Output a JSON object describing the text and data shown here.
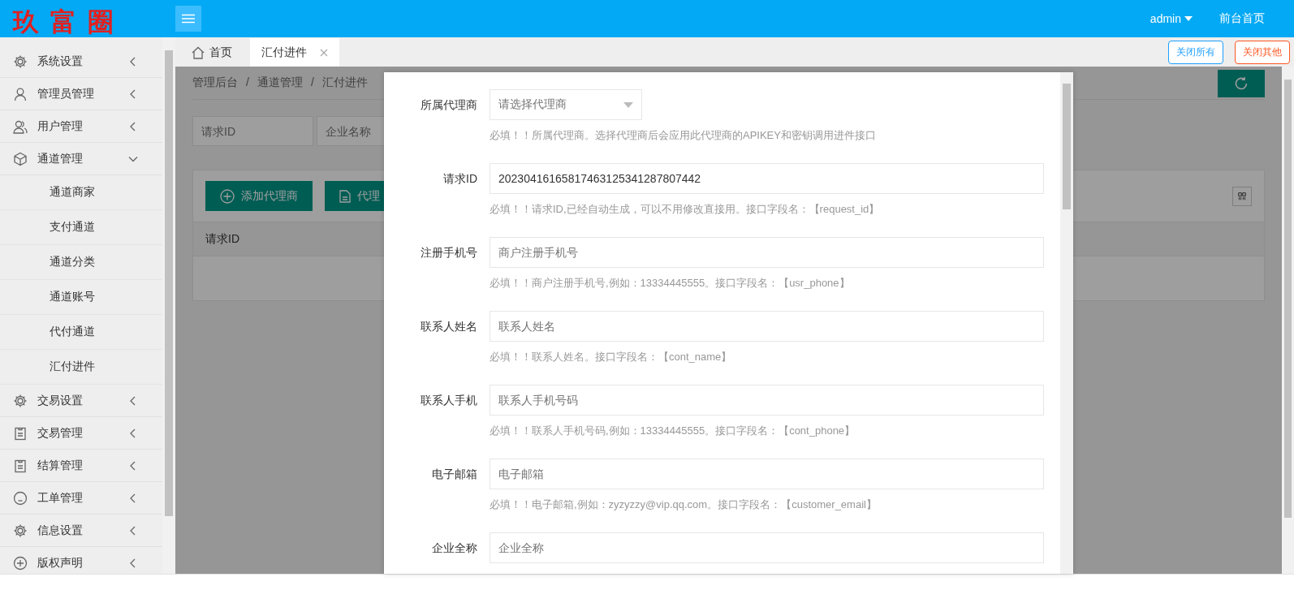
{
  "header": {
    "logo": "玖富圈",
    "user": "admin",
    "home_link": "前台首页"
  },
  "sidebar": {
    "items": [
      {
        "label": "系统设置",
        "expanded": false
      },
      {
        "label": "管理员管理",
        "expanded": false
      },
      {
        "label": "用户管理",
        "expanded": false
      },
      {
        "label": "通道管理",
        "expanded": true,
        "children": [
          {
            "label": "通道商家"
          },
          {
            "label": "支付通道"
          },
          {
            "label": "通道分类"
          },
          {
            "label": "通道账号"
          },
          {
            "label": "代付通道"
          },
          {
            "label": "汇付进件"
          }
        ]
      },
      {
        "label": "交易设置",
        "expanded": false
      },
      {
        "label": "交易管理",
        "expanded": false
      },
      {
        "label": "结算管理",
        "expanded": false
      },
      {
        "label": "工单管理",
        "expanded": false
      },
      {
        "label": "信息设置",
        "expanded": false
      },
      {
        "label": "版权声明",
        "expanded": false
      }
    ]
  },
  "tabs": [
    {
      "label": "首页",
      "selected": false,
      "closable": false
    },
    {
      "label": "汇付进件",
      "selected": true,
      "closable": true
    }
  ],
  "tab_actions": [
    {
      "label": "关闭所有",
      "kind": "primary"
    },
    {
      "label": "关闭其他",
      "kind": "danger"
    }
  ],
  "page": {
    "breadcrumb": {
      "separator": "/",
      "items": [
        "管理后台",
        "通道管理",
        "汇付进件"
      ]
    },
    "search_fields": [
      {
        "placeholder": "请求ID"
      },
      {
        "placeholder": "企业名称"
      }
    ],
    "toolbar_buttons": [
      {
        "label": "添加代理商",
        "kind": "add"
      },
      {
        "label": "代理",
        "kind": "doc"
      }
    ],
    "table": {
      "columns": [
        "请求ID"
      ]
    }
  },
  "modal": {
    "fields": [
      {
        "kind": "select",
        "label": "所属代理商",
        "placeholder": "请选择代理商",
        "hint": "必填！！所属代理商。选择代理商后会应用此代理商的APIKEY和密钥调用进件接口"
      },
      {
        "kind": "text",
        "label": "请求ID",
        "value": "20230416165817463125341287807442",
        "hint": "必填！！请求ID,已经自动生成，可以不用修改直接用。接口字段名：【request_id】"
      },
      {
        "kind": "text",
        "label": "注册手机号",
        "placeholder": "商户注册手机号",
        "hint": "必填！！商户注册手机号,例如：13334445555。接口字段名：【usr_phone】"
      },
      {
        "kind": "text",
        "label": "联系人姓名",
        "placeholder": "联系人姓名",
        "hint": "必填！！联系人姓名。接口字段名：【cont_name】"
      },
      {
        "kind": "text",
        "label": "联系人手机",
        "placeholder": "联系人手机号码",
        "hint": "必填！！联系人手机号码,例如：13334445555。接口字段名：【cont_phone】"
      },
      {
        "kind": "text",
        "label": "电子邮箱",
        "placeholder": "电子邮箱",
        "hint": "必填！！电子邮箱,例如：zyzyzzy@vip.qq.com。接口字段名：【customer_email】"
      },
      {
        "kind": "text",
        "label": "企业全称",
        "placeholder": "企业全称"
      }
    ]
  }
}
